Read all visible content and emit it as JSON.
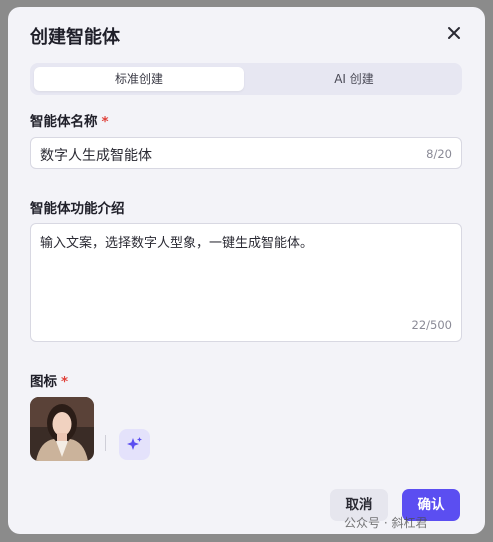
{
  "dialog": {
    "title": "创建智能体",
    "close_icon": "close-icon"
  },
  "tabs": [
    {
      "label": "标准创建",
      "active": true
    },
    {
      "label": "AI 创建",
      "active": false
    }
  ],
  "name_field": {
    "label": "智能体名称",
    "required_mark": "*",
    "value": "数字人生成智能体",
    "counter": "8/20"
  },
  "description_field": {
    "label": "智能体功能介绍",
    "value": "输入文案，选择数字人型象，一键生成智能体。",
    "counter": "22/500"
  },
  "icon_field": {
    "label": "图标",
    "required_mark": "*",
    "avatar_icon": "avatar-image",
    "ai_generate_icon": "sparkle-icon"
  },
  "footer": {
    "cancel_label": "取消",
    "confirm_label": "确认"
  },
  "watermark": "公众号 · 斜杠君",
  "colors": {
    "accent": "#5b4ef1",
    "required": "#e0413a",
    "background": "#f3f3f8"
  }
}
